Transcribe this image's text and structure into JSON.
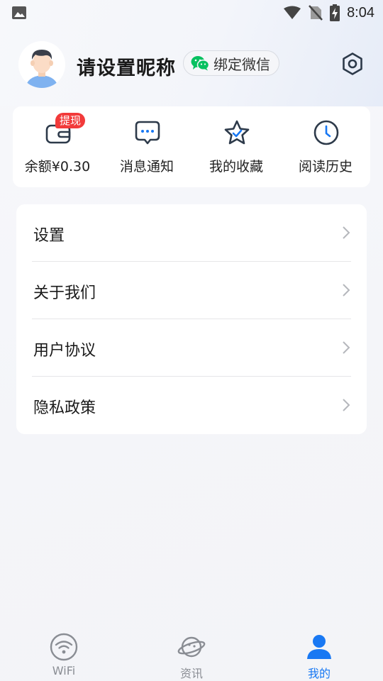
{
  "status_bar": {
    "time": "8:04",
    "icons": [
      "gallery-icon",
      "wifi-signal-icon",
      "no-sim-icon",
      "battery-charging-icon"
    ]
  },
  "profile": {
    "nickname": "请设置昵称",
    "bind_wechat_label": "绑定微信",
    "icons": [
      "avatar",
      "wechat-icon",
      "settings-icon"
    ]
  },
  "quick_actions": [
    {
      "label": "余额¥0.30",
      "icon": "wallet-icon",
      "badge": "提现"
    },
    {
      "label": "消息通知",
      "icon": "message-icon"
    },
    {
      "label": "我的收藏",
      "icon": "star-icon"
    },
    {
      "label": "阅读历史",
      "icon": "clock-icon"
    }
  ],
  "menu": [
    {
      "label": "设置"
    },
    {
      "label": "关于我们"
    },
    {
      "label": "用户协议"
    },
    {
      "label": "隐私政策"
    }
  ],
  "bottom_nav": [
    {
      "label": "WiFi",
      "icon": "wifi-icon",
      "active": false
    },
    {
      "label": "资讯",
      "icon": "planet-icon",
      "active": false
    },
    {
      "label": "我的",
      "icon": "user-icon",
      "active": true
    }
  ],
  "colors": {
    "accent": "#1878f3",
    "badge": "#f23a3a",
    "wechat": "#07c160",
    "icon_dark": "#2d3a4a"
  }
}
